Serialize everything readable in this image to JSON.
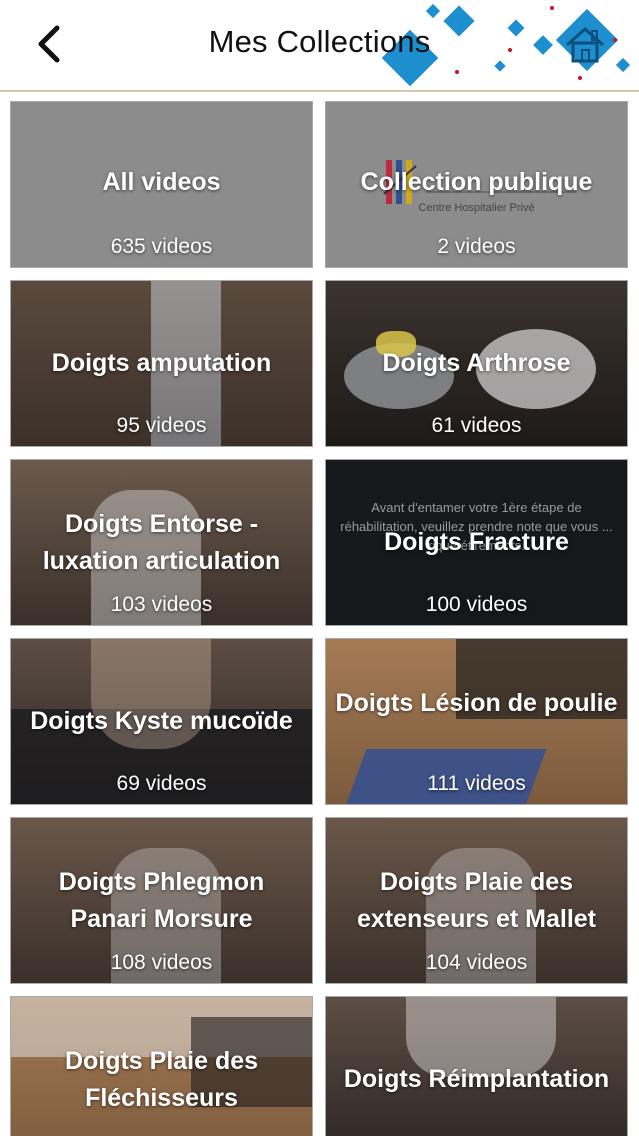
{
  "header": {
    "title": "Mes Collections",
    "back_icon": "chevron-left-icon",
    "home_icon": "home-icon",
    "accent_color": "#1d8fcf"
  },
  "collections": [
    {
      "title": "All videos",
      "count": "635 videos"
    },
    {
      "title": "Collection publique",
      "count": "2 videos",
      "logo_text": "Centre Hospitalier Privé"
    },
    {
      "title": "Doigts amputation",
      "count": "95 videos"
    },
    {
      "title": "Doigts Arthrose",
      "count": "61 videos"
    },
    {
      "title": "Doigts Entorse - luxation articulation",
      "count": "103 videos"
    },
    {
      "title": "Doigts Fracture",
      "count": "100 videos",
      "overlay_text": "Avant d'entamer votre 1ère étape de réhabilitation, veuillez prendre note que vous ... rique étirements."
    },
    {
      "title": "Doigts Kyste mucoïde",
      "count": "69 videos"
    },
    {
      "title": "Doigts Lésion de poulie",
      "count": "111 videos"
    },
    {
      "title": "Doigts Phlegmon Panari Morsure",
      "count": "108 videos"
    },
    {
      "title": "Doigts Plaie des extenseurs et Mallet",
      "count": "104 videos"
    },
    {
      "title": "Doigts Plaie des Fléchisseurs",
      "count": ""
    },
    {
      "title": "Doigts Réimplantation",
      "count": ""
    }
  ]
}
